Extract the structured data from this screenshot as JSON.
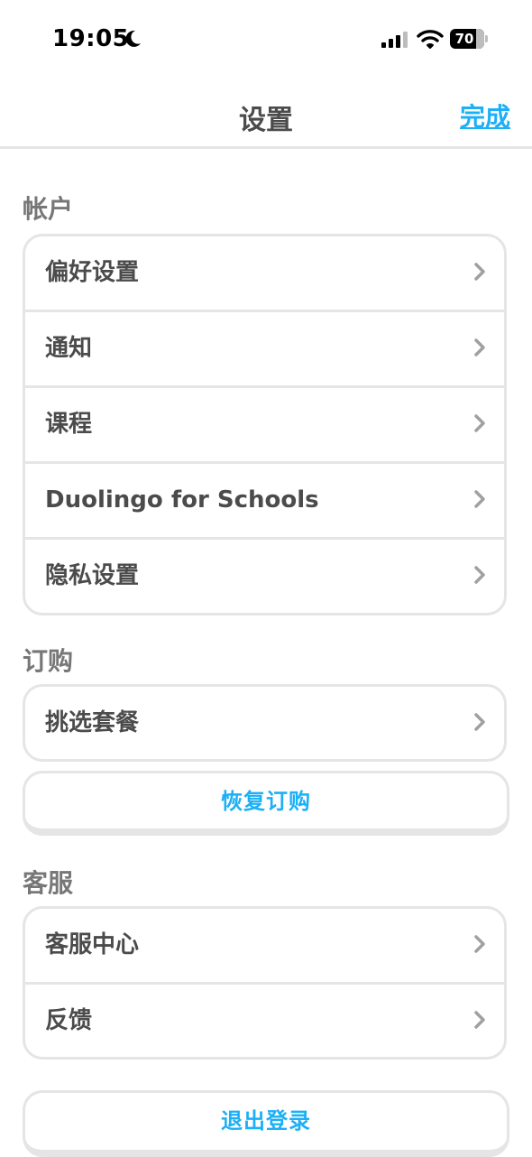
{
  "status_bar": {
    "time": "19:05",
    "battery": "70"
  },
  "nav": {
    "title": "设置",
    "done_label": "完成"
  },
  "sections": {
    "account": {
      "header": "帐户",
      "items": [
        {
          "label": "偏好设置"
        },
        {
          "label": "通知"
        },
        {
          "label": "课程"
        },
        {
          "label": "Duolingo for Schools"
        },
        {
          "label": "隐私设置"
        }
      ]
    },
    "subscription": {
      "header": "订购",
      "items": [
        {
          "label": "挑选套餐"
        }
      ],
      "restore_label": "恢复订购"
    },
    "support": {
      "header": "客服",
      "items": [
        {
          "label": "客服中心"
        },
        {
          "label": "反馈"
        }
      ]
    }
  },
  "logout_label": "退出登录",
  "colors": {
    "accent": "#1cb0f6",
    "text": "#4b4b4b",
    "border": "#e5e5e5",
    "header": "#777777"
  }
}
